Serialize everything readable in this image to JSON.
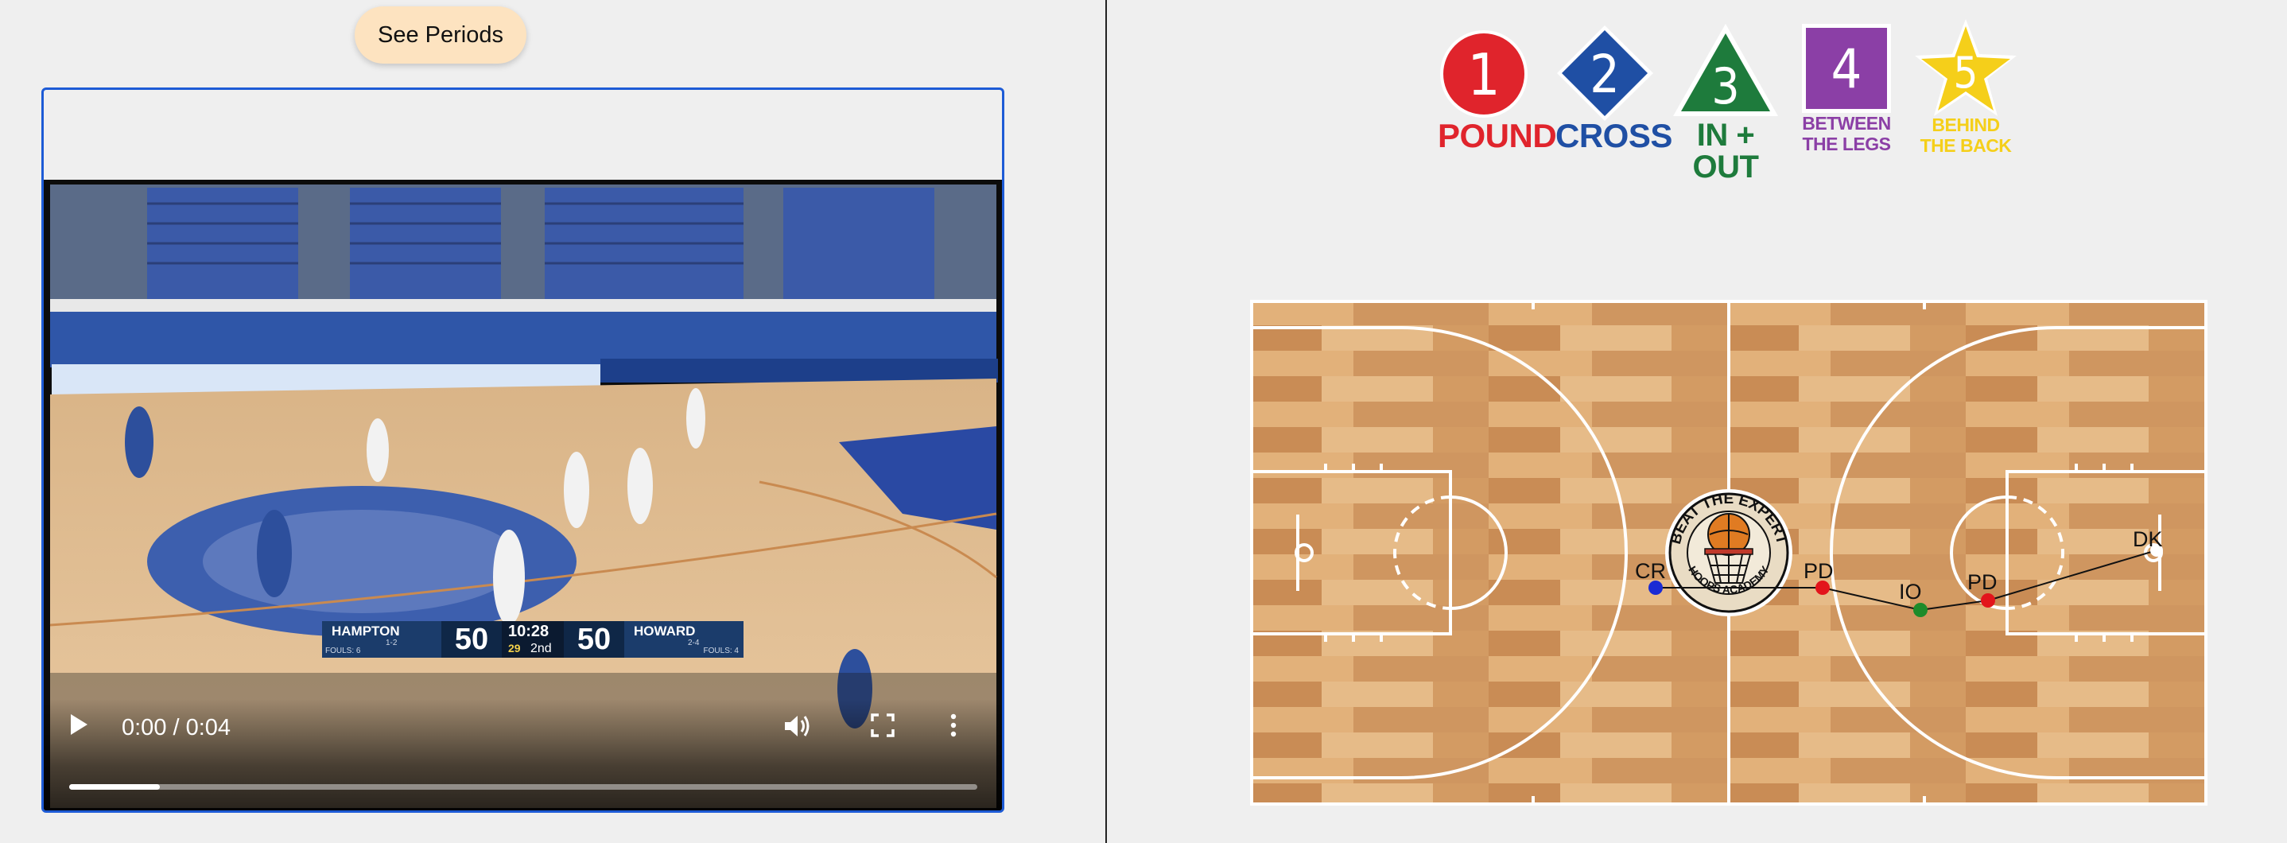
{
  "see_periods_label": "See Periods",
  "video": {
    "time": "0:00 / 0:04",
    "progress": 0.1,
    "scoreboard": {
      "team1": "HAMPTON",
      "team1_record": "1-2",
      "team1_fouls": "FOULS: 6",
      "score1": "50",
      "clock": "10:28",
      "shot_clock": "29",
      "period": "2nd",
      "score2": "50",
      "team2": "HOWARD",
      "team2_record": "2-4",
      "team2_fouls": "FOULS: 4"
    }
  },
  "legend": [
    {
      "num": "1",
      "label": "POUND",
      "shape": "circle",
      "color": "#e0242c"
    },
    {
      "num": "2",
      "label": "CROSS",
      "shape": "diamond",
      "color": "#1f4fa4"
    },
    {
      "num": "3",
      "label": "IN + OUT",
      "shape": "triangle",
      "color": "#1e7b3c"
    },
    {
      "num": "4",
      "label_line1": "BETWEEN",
      "label_line2": "THE LEGS",
      "shape": "square",
      "color": "#8b3fa6"
    },
    {
      "num": "5",
      "label_line1": "BEHIND",
      "label_line2": "THE BACK",
      "shape": "star",
      "color": "#f5cf1a"
    }
  ],
  "court": {
    "logo_line1": "BEAT THE EXPERT",
    "logo_line2": "HOOPS ACADEMY",
    "markers": [
      {
        "label": "CR",
        "color": "#1a2bd4"
      },
      {
        "label": "PD",
        "color": "#e3141b"
      },
      {
        "label": "IO",
        "color": "#1d8b2a"
      },
      {
        "label": "PD",
        "color": "#e3141b"
      },
      {
        "label": "DK",
        "color": "#ffffff"
      }
    ]
  }
}
